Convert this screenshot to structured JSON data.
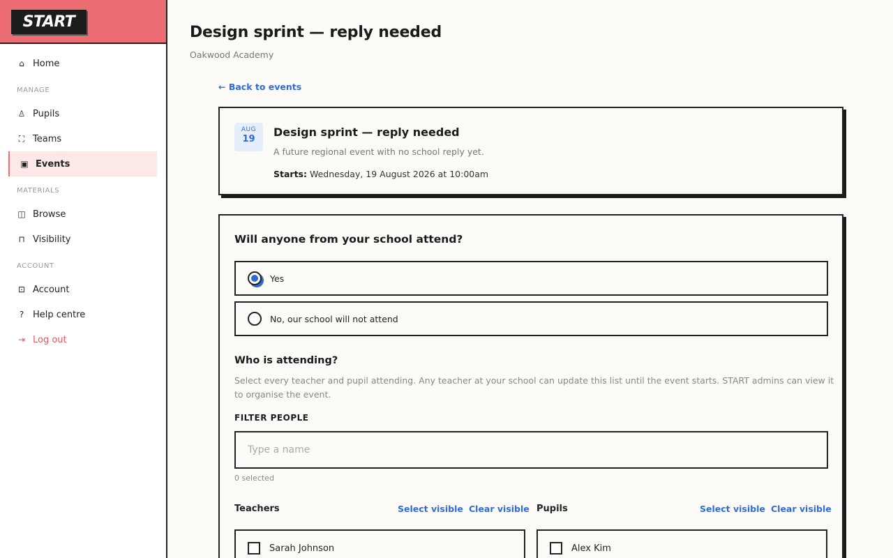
{
  "sidebar": {
    "logo": "START",
    "sections": {
      "manage": "MANAGE",
      "materials": "MATERIALS",
      "account": "ACCOUNT"
    },
    "items": {
      "home": "Home",
      "pupils": "Pupils",
      "teams": "Teams",
      "events": "Events",
      "browse": "Browse",
      "visibility": "Visibility",
      "account": "Account",
      "help": "Help centre",
      "logout": "Log out"
    }
  },
  "header": {
    "title": "Design sprint — reply needed",
    "subtitle": "Oakwood Academy",
    "back_link": "← Back to events"
  },
  "event": {
    "month": "AUG",
    "day": "19",
    "title": "Design sprint — reply needed",
    "description": "A future regional event with no school reply yet.",
    "starts_label": "Starts:",
    "starts_value": "Wednesday, 19 August 2026 at 10:00am"
  },
  "reply": {
    "question": "Will anyone from your school attend?",
    "options": [
      {
        "label": "Yes",
        "selected": true
      },
      {
        "label": "No, our school will not attend",
        "selected": false
      }
    ],
    "who_title": "Who is attending?",
    "who_desc": "Select every teacher and pupil attending. Any teacher at your school can update this list until the event starts. START admins can view it to organise the event.",
    "filter_label": "FILTER PEOPLE",
    "filter_placeholder": "Type a name",
    "filter_value": "",
    "selected_count": "0 selected",
    "teachers": {
      "heading": "Teachers",
      "select_visible": "Select visible",
      "clear_visible": "Clear visible",
      "people": [
        "Sarah Johnson"
      ]
    },
    "pupils": {
      "heading": "Pupils",
      "select_visible": "Select visible",
      "clear_visible": "Clear visible",
      "people": [
        "Alex Kim"
      ]
    }
  },
  "colors": {
    "brand": "#ed6e72",
    "accent": "#2f6bd8",
    "active_bg": "#fde8e8"
  }
}
